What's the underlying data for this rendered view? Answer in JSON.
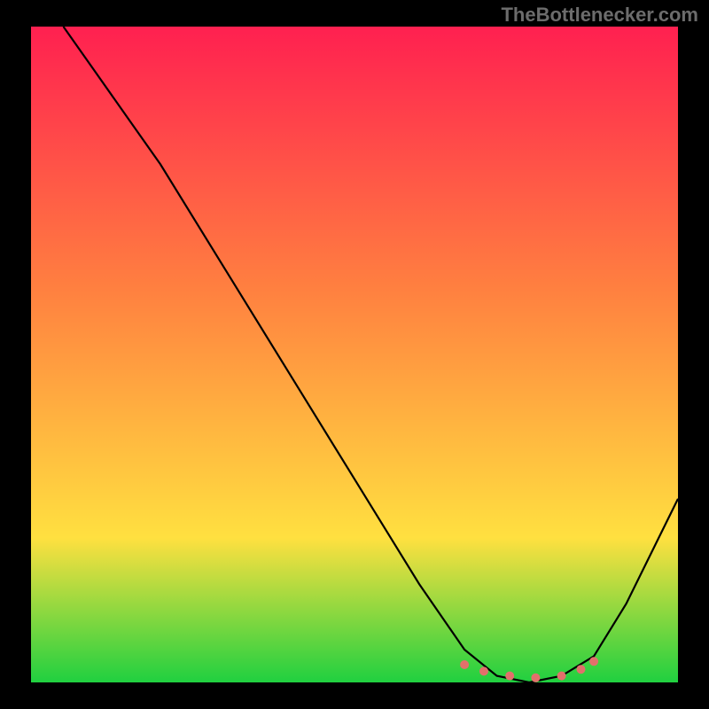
{
  "watermark": "TheBottlenecker.com",
  "chart_data": {
    "type": "line",
    "title": "",
    "xlabel": "",
    "ylabel": "",
    "xlim": [
      0,
      1
    ],
    "ylim": [
      0,
      1
    ],
    "background_gradient": {
      "top": "#ff2050",
      "upper_mid": "#ff8040",
      "lower_mid": "#ffe040",
      "bottom": "#20d040"
    },
    "series": [
      {
        "name": "curve",
        "color": "#000000",
        "x": [
          0.05,
          0.1,
          0.15,
          0.2,
          0.3,
          0.4,
          0.5,
          0.6,
          0.67,
          0.72,
          0.77,
          0.82,
          0.87,
          0.92,
          1.0
        ],
        "y": [
          1.0,
          0.93,
          0.86,
          0.79,
          0.63,
          0.47,
          0.31,
          0.15,
          0.05,
          0.01,
          0.0,
          0.01,
          0.04,
          0.12,
          0.28
        ]
      },
      {
        "name": "highlight",
        "color": "#e2706b",
        "x": [
          0.67,
          0.7,
          0.74,
          0.78,
          0.82,
          0.85,
          0.87
        ],
        "y": [
          0.027,
          0.017,
          0.01,
          0.007,
          0.01,
          0.02,
          0.032
        ]
      }
    ]
  }
}
